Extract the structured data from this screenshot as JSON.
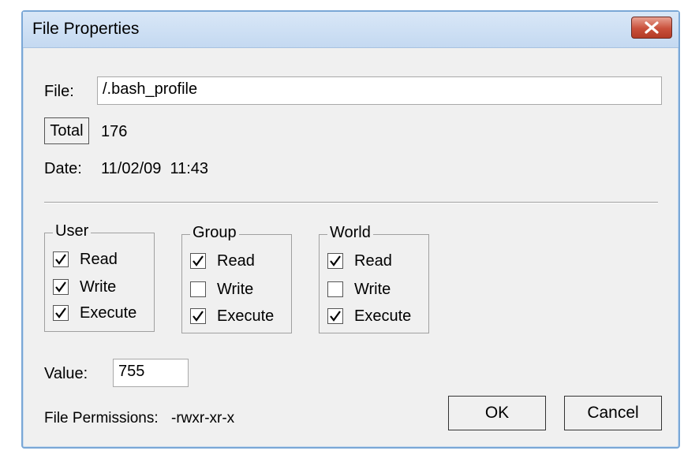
{
  "window": {
    "title": "File Properties"
  },
  "file": {
    "label": "File:",
    "value": "/.bash_profile"
  },
  "total": {
    "button_label": "Total",
    "value": "176"
  },
  "date": {
    "label": "Date:",
    "value": "11/02/09  11:43"
  },
  "groups": [
    {
      "title": "User",
      "items": [
        {
          "label": "Read",
          "checked": true
        },
        {
          "label": "Write",
          "checked": true
        },
        {
          "label": "Execute",
          "checked": true
        }
      ]
    },
    {
      "title": "Group",
      "items": [
        {
          "label": "Read",
          "checked": true
        },
        {
          "label": "Write",
          "checked": false
        },
        {
          "label": "Execute",
          "checked": true
        }
      ]
    },
    {
      "title": "World",
      "items": [
        {
          "label": "Read",
          "checked": true
        },
        {
          "label": "Write",
          "checked": false
        },
        {
          "label": "Execute",
          "checked": true
        }
      ]
    }
  ],
  "value": {
    "label": "Value:",
    "value": "755"
  },
  "permissions": {
    "label": "File Permissions:",
    "value": "-rwxr-xr-x"
  },
  "buttons": {
    "ok": "OK",
    "cancel": "Cancel"
  }
}
